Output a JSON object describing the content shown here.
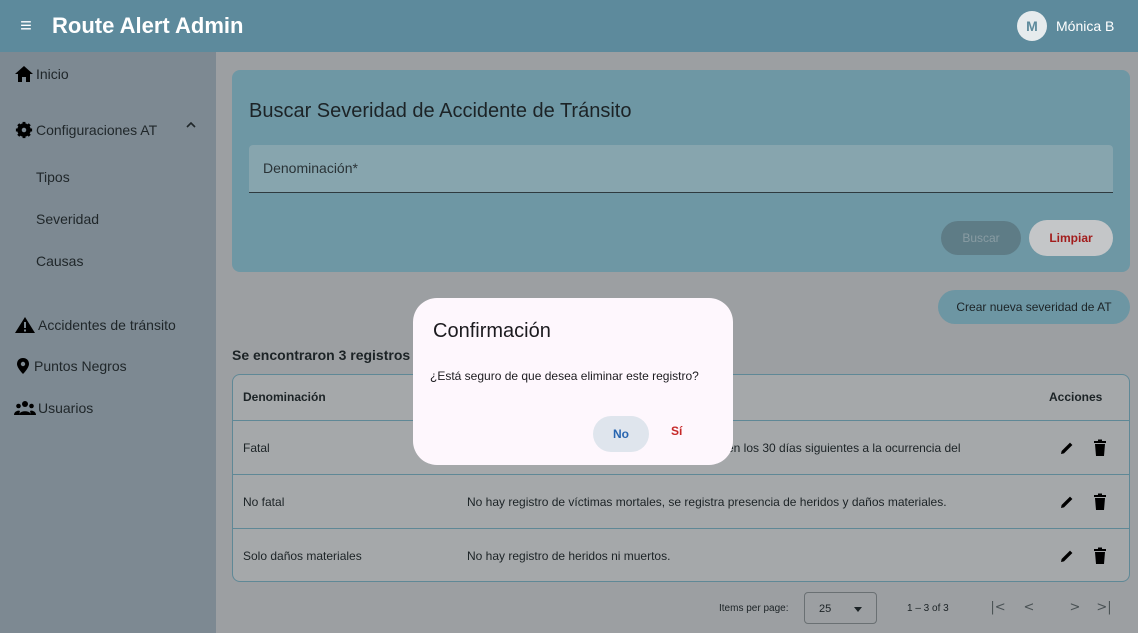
{
  "app": {
    "title": "Route Alert Admin",
    "menu_icon": "menu-icon",
    "user": {
      "initial": "M",
      "name": "Mónica B"
    }
  },
  "sidebar": {
    "items": [
      {
        "label": "Inicio",
        "icon": "home-icon"
      },
      {
        "label": "Configuraciones AT",
        "icon": "gear-icon",
        "expanded": true,
        "children": [
          "Tipos",
          "Severidad",
          "Causas"
        ]
      },
      {
        "label": "Accidentes de tránsito",
        "icon": "warning-icon"
      },
      {
        "label": "Puntos Negros",
        "icon": "map-pin-icon"
      },
      {
        "label": "Usuarios",
        "icon": "group-icon"
      }
    ]
  },
  "search": {
    "title": "Buscar Severidad de Accidente de Tránsito",
    "field_label": "Denominación*",
    "buscar_label": "Buscar",
    "limpiar_label": "Limpiar"
  },
  "actions": {
    "create_label": "Crear nueva severidad de AT"
  },
  "results": {
    "count_text": "Se encontraron 3 registros"
  },
  "table": {
    "headers": {
      "name": "Denominación",
      "actions": "Acciones"
    },
    "rows": [
      {
        "name": "Fatal",
        "description": "en los 30 días siguientes a la ocurrencia del"
      },
      {
        "name": "No fatal",
        "description": "No hay registro de víctimas mortales, se registra presencia de heridos y daños materiales."
      },
      {
        "name": "Solo daños materiales",
        "description": "No hay registro de heridos ni muertos."
      }
    ]
  },
  "paginator": {
    "items_per_page_label": "Items per page:",
    "page_size": "25",
    "range_label": "1 – 3 of 3"
  },
  "dialog": {
    "title": "Confirmación",
    "message": "¿Está seguro de que desea eliminar este registro?",
    "no_label": "No",
    "yes_label": "Sí"
  },
  "colors": {
    "header": "#5d8a9c",
    "card": "#6e97a4",
    "danger": "#c62828",
    "primary": "#2865b0"
  }
}
